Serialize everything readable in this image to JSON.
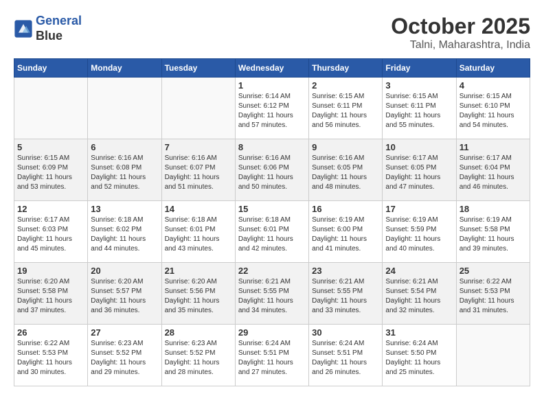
{
  "header": {
    "logo_line1": "General",
    "logo_line2": "Blue",
    "month_title": "October 2025",
    "location": "Talni, Maharashtra, India"
  },
  "weekdays": [
    "Sunday",
    "Monday",
    "Tuesday",
    "Wednesday",
    "Thursday",
    "Friday",
    "Saturday"
  ],
  "weeks": [
    [
      {
        "day": "",
        "info": ""
      },
      {
        "day": "",
        "info": ""
      },
      {
        "day": "",
        "info": ""
      },
      {
        "day": "1",
        "info": "Sunrise: 6:14 AM\nSunset: 6:12 PM\nDaylight: 11 hours and 57 minutes."
      },
      {
        "day": "2",
        "info": "Sunrise: 6:15 AM\nSunset: 6:11 PM\nDaylight: 11 hours and 56 minutes."
      },
      {
        "day": "3",
        "info": "Sunrise: 6:15 AM\nSunset: 6:11 PM\nDaylight: 11 hours and 55 minutes."
      },
      {
        "day": "4",
        "info": "Sunrise: 6:15 AM\nSunset: 6:10 PM\nDaylight: 11 hours and 54 minutes."
      }
    ],
    [
      {
        "day": "5",
        "info": "Sunrise: 6:15 AM\nSunset: 6:09 PM\nDaylight: 11 hours and 53 minutes."
      },
      {
        "day": "6",
        "info": "Sunrise: 6:16 AM\nSunset: 6:08 PM\nDaylight: 11 hours and 52 minutes."
      },
      {
        "day": "7",
        "info": "Sunrise: 6:16 AM\nSunset: 6:07 PM\nDaylight: 11 hours and 51 minutes."
      },
      {
        "day": "8",
        "info": "Sunrise: 6:16 AM\nSunset: 6:06 PM\nDaylight: 11 hours and 50 minutes."
      },
      {
        "day": "9",
        "info": "Sunrise: 6:16 AM\nSunset: 6:05 PM\nDaylight: 11 hours and 48 minutes."
      },
      {
        "day": "10",
        "info": "Sunrise: 6:17 AM\nSunset: 6:05 PM\nDaylight: 11 hours and 47 minutes."
      },
      {
        "day": "11",
        "info": "Sunrise: 6:17 AM\nSunset: 6:04 PM\nDaylight: 11 hours and 46 minutes."
      }
    ],
    [
      {
        "day": "12",
        "info": "Sunrise: 6:17 AM\nSunset: 6:03 PM\nDaylight: 11 hours and 45 minutes."
      },
      {
        "day": "13",
        "info": "Sunrise: 6:18 AM\nSunset: 6:02 PM\nDaylight: 11 hours and 44 minutes."
      },
      {
        "day": "14",
        "info": "Sunrise: 6:18 AM\nSunset: 6:01 PM\nDaylight: 11 hours and 43 minutes."
      },
      {
        "day": "15",
        "info": "Sunrise: 6:18 AM\nSunset: 6:01 PM\nDaylight: 11 hours and 42 minutes."
      },
      {
        "day": "16",
        "info": "Sunrise: 6:19 AM\nSunset: 6:00 PM\nDaylight: 11 hours and 41 minutes."
      },
      {
        "day": "17",
        "info": "Sunrise: 6:19 AM\nSunset: 5:59 PM\nDaylight: 11 hours and 40 minutes."
      },
      {
        "day": "18",
        "info": "Sunrise: 6:19 AM\nSunset: 5:58 PM\nDaylight: 11 hours and 39 minutes."
      }
    ],
    [
      {
        "day": "19",
        "info": "Sunrise: 6:20 AM\nSunset: 5:58 PM\nDaylight: 11 hours and 37 minutes."
      },
      {
        "day": "20",
        "info": "Sunrise: 6:20 AM\nSunset: 5:57 PM\nDaylight: 11 hours and 36 minutes."
      },
      {
        "day": "21",
        "info": "Sunrise: 6:20 AM\nSunset: 5:56 PM\nDaylight: 11 hours and 35 minutes."
      },
      {
        "day": "22",
        "info": "Sunrise: 6:21 AM\nSunset: 5:55 PM\nDaylight: 11 hours and 34 minutes."
      },
      {
        "day": "23",
        "info": "Sunrise: 6:21 AM\nSunset: 5:55 PM\nDaylight: 11 hours and 33 minutes."
      },
      {
        "day": "24",
        "info": "Sunrise: 6:21 AM\nSunset: 5:54 PM\nDaylight: 11 hours and 32 minutes."
      },
      {
        "day": "25",
        "info": "Sunrise: 6:22 AM\nSunset: 5:53 PM\nDaylight: 11 hours and 31 minutes."
      }
    ],
    [
      {
        "day": "26",
        "info": "Sunrise: 6:22 AM\nSunset: 5:53 PM\nDaylight: 11 hours and 30 minutes."
      },
      {
        "day": "27",
        "info": "Sunrise: 6:23 AM\nSunset: 5:52 PM\nDaylight: 11 hours and 29 minutes."
      },
      {
        "day": "28",
        "info": "Sunrise: 6:23 AM\nSunset: 5:52 PM\nDaylight: 11 hours and 28 minutes."
      },
      {
        "day": "29",
        "info": "Sunrise: 6:24 AM\nSunset: 5:51 PM\nDaylight: 11 hours and 27 minutes."
      },
      {
        "day": "30",
        "info": "Sunrise: 6:24 AM\nSunset: 5:51 PM\nDaylight: 11 hours and 26 minutes."
      },
      {
        "day": "31",
        "info": "Sunrise: 6:24 AM\nSunset: 5:50 PM\nDaylight: 11 hours and 25 minutes."
      },
      {
        "day": "",
        "info": ""
      }
    ]
  ]
}
